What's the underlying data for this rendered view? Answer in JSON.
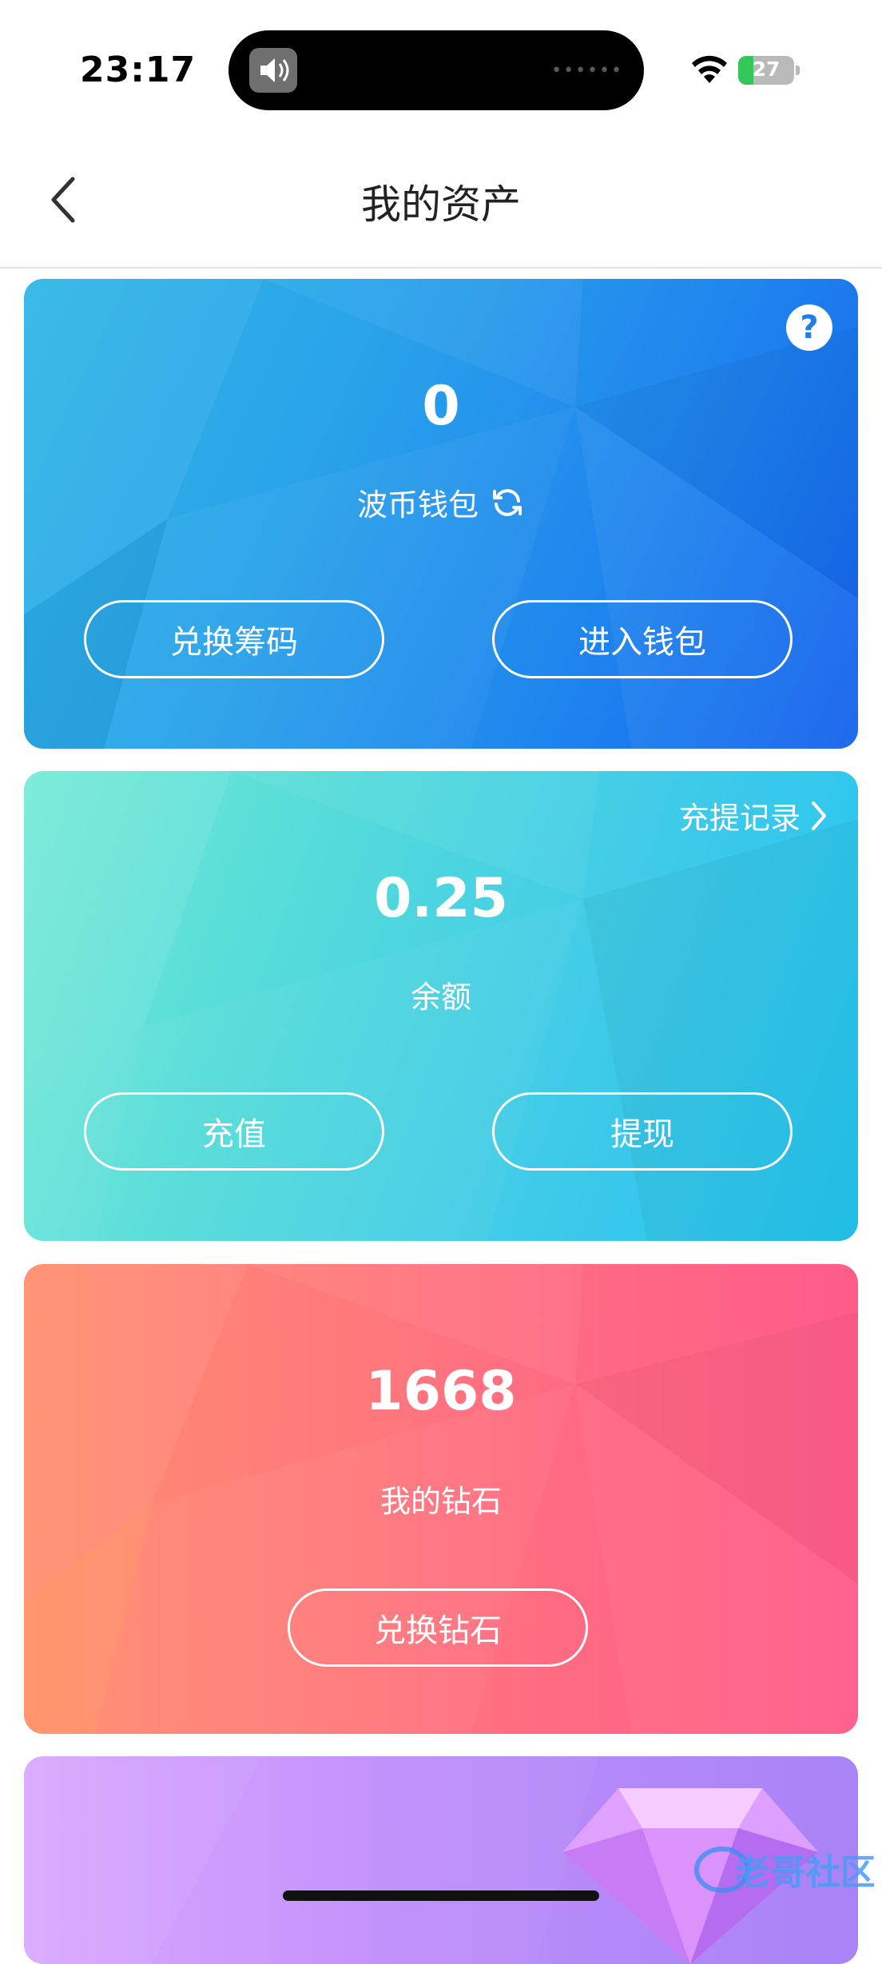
{
  "status_bar": {
    "time": "23:17",
    "battery_level": "27"
  },
  "nav": {
    "title": "我的资产",
    "back_icon": "chevron-left-icon"
  },
  "cards": {
    "wallet": {
      "amount": "0",
      "label": "波币钱包",
      "help_icon": "question-icon",
      "refresh_icon": "refresh-icon",
      "buttons": [
        "兑换筹码",
        "进入钱包"
      ]
    },
    "balance": {
      "amount": "0.25",
      "label": "余额",
      "records_link": "充提记录",
      "buttons": [
        "充值",
        "提现"
      ]
    },
    "diamonds": {
      "amount": "1668",
      "label": "我的钻石",
      "button": "兑换钻石"
    },
    "fourth": {
      "image": "diamond-gem-image"
    }
  },
  "watermark": {
    "text": "老哥社区"
  },
  "colors": {
    "wallet_card": "#1e84ee",
    "balance_card": "#3cc9ea",
    "diamond_card": "#ff6884",
    "fourth_card": "#bf8dfb"
  }
}
